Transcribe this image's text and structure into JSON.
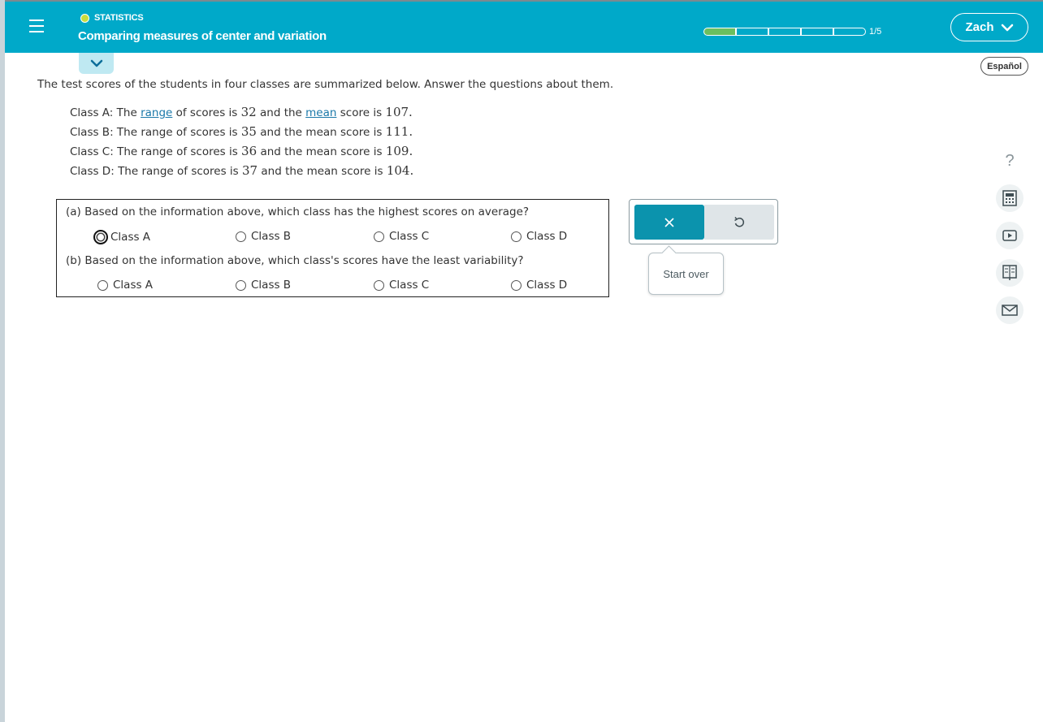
{
  "header": {
    "topic": "STATISTICS",
    "lesson_title": "Comparing measures of center and variation",
    "progress_text": "1/5",
    "progress": {
      "completed_segments": 1,
      "total_segments": 5
    },
    "user_name": "Zach"
  },
  "language_button": "Español",
  "intro": "The test scores of the students in four classes are summarized below. Answer the questions about them.",
  "classes": [
    {
      "label": "Class A:",
      "text_1": "The",
      "range_word": "range",
      "text_2": "of scores is",
      "range": "32",
      "text_3": "and the",
      "mean_word": "mean",
      "text_4": "score is",
      "mean": "107",
      "end": "."
    },
    {
      "label": "Class B:",
      "text_1": "The",
      "range_word": "range",
      "text_2": "of scores is",
      "range": "35",
      "text_3": "and the",
      "mean_word": "mean",
      "text_4": "score is",
      "mean": "111",
      "end": "."
    },
    {
      "label": "Class C:",
      "text_1": "The",
      "range_word": "range",
      "text_2": "of scores is",
      "range": "36",
      "text_3": "and the",
      "mean_word": "mean",
      "text_4": "score is",
      "mean": "109",
      "end": "."
    },
    {
      "label": "Class D:",
      "text_1": "The",
      "range_word": "range",
      "text_2": "of scores is",
      "range": "37",
      "text_3": "and the",
      "mean_word": "mean",
      "text_4": "score is",
      "mean": "104",
      "end": "."
    }
  ],
  "question_a": {
    "text": "(a) Based on the information above, which class has the highest scores on average?",
    "options": [
      "Class A",
      "Class B",
      "Class C",
      "Class D"
    ],
    "focused_option": "Class A"
  },
  "question_b": {
    "text": "(b) Based on the information above, which class's scores have the least variability?",
    "options": [
      "Class A",
      "Class B",
      "Class C",
      "Class D"
    ]
  },
  "tooltip": "Start over",
  "tools": [
    "help-icon",
    "calculator-icon",
    "video-icon",
    "ebook-icon",
    "message-icon"
  ],
  "colors": {
    "header": "#00a9c9",
    "link": "#1b78a9",
    "primary_button": "#0b93ad",
    "progress_done": "#6bbf5f"
  }
}
